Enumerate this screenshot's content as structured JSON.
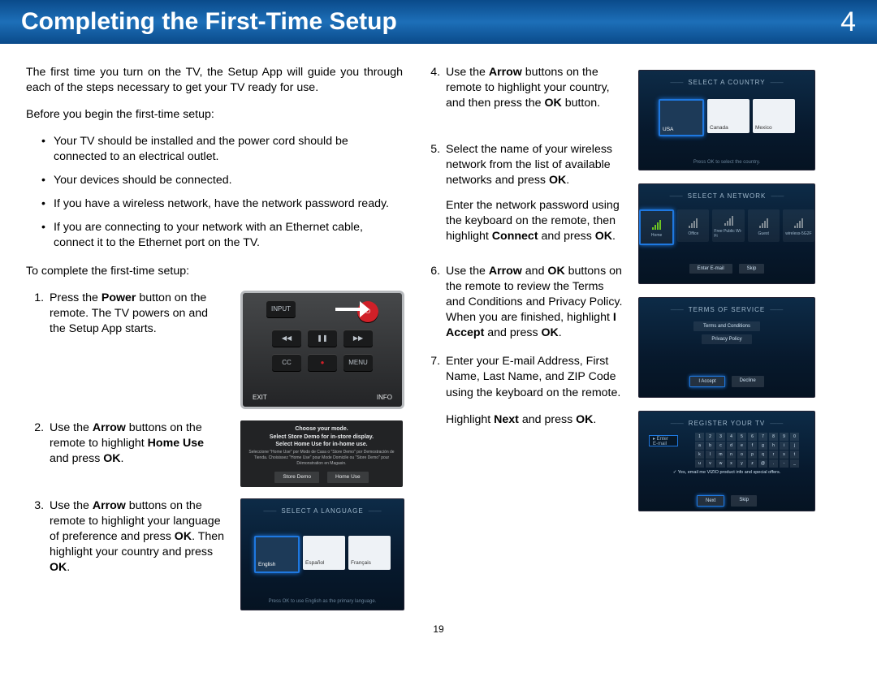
{
  "header": {
    "title": "Completing the First-Time Setup",
    "chapter": "4"
  },
  "page_num": "19",
  "intro": "The first time you turn on the TV, the Setup App will guide you through each of the steps necessary to get your TV ready for use.",
  "before": {
    "lead": "Before you begin the first-time setup:",
    "items": [
      "Your TV should be installed and the power cord should be connected to an electrical outlet.",
      "Your devices should be connected.",
      "If you have a wireless network, have the network password ready.",
      "If you are connecting to your network with an Ethernet cable, connect it to the Ethernet port on the TV."
    ]
  },
  "to_complete": "To complete the first-time setup:",
  "steps_left": [
    {
      "pre": " Press the ",
      "b1": "Power",
      "mid": " button on the remote. The TV powers on and the Setup App starts."
    },
    {
      "pre": "Use the ",
      "b1": "Arrow",
      "mid": " buttons on the remote to highlight ",
      "b2": "Home Use",
      "post": " and press ",
      "b3": "OK",
      "end": "."
    },
    {
      "pre": "Use the ",
      "b1": "Arrow",
      "mid": " buttons on the remote to highlight your language of preference and press ",
      "b2": "OK",
      "post": ". Then highlight your country and press ",
      "b3": "OK",
      "end": "."
    }
  ],
  "steps_right": [
    {
      "pre": "Use the ",
      "b1": "Arrow",
      "mid": " buttons on the remote to highlight your country, and then press the ",
      "b2": "OK",
      "post": " button."
    },
    {
      "p1": {
        "pre": "Select the name of your wireless network from the list of available networks and press ",
        "b1": "OK",
        "post": "."
      },
      "p2": {
        "pre": "Enter the network password using the keyboard on the remote, then highlight ",
        "b1": "Connect",
        "mid": " and press ",
        "b2": "OK",
        "post": "."
      }
    },
    {
      "pre": "Use the ",
      "b1": "Arrow",
      "mid": " and ",
      "b2": "OK",
      "mid2": " buttons on the remote to review the Terms and Conditions and Privacy Policy. When you are finished, highlight ",
      "b3": "I Accept",
      "post": " and press ",
      "b4": "OK",
      "end": "."
    },
    {
      "p1": {
        "text": "Enter your E-mail Address, First Name, Last Name, and ZIP Code using the keyboard on the remote."
      },
      "p2": {
        "pre": "Highlight ",
        "b1": "Next",
        "mid": " and press ",
        "b2": "OK",
        "post": "."
      }
    }
  ],
  "remote": {
    "input": "INPUT",
    "exit": "EXIT",
    "info": "INFO",
    "cc": "CC",
    "rec": "●",
    "menu": "MENU",
    "rew": "◀◀",
    "pause": "❚❚",
    "ff": "▶▶",
    "power": "⏻"
  },
  "mode": {
    "l1": "Choose your mode.",
    "l2": "Select Store Demo for in-store display.",
    "l3": "Select Home Use for in-home use.",
    "sub": "Seleccione \"Home Use\" por Modo de Casa o \"Store Demo\" por Demostración de Tienda. Choisissez \"Home Use\" pour Mode Domicile ou \"Store Demo\" pour Démonstration en Magasin.",
    "btn1": "Store Demo",
    "btn2": "Home Use"
  },
  "lang": {
    "title": "SELECT A LANGUAGE",
    "opt1": "English",
    "opt2": "Español",
    "opt3": "Français",
    "footer": "Press OK to use English as the primary language."
  },
  "country": {
    "title": "SELECT A COUNTRY",
    "opt1": "USA",
    "opt2": "Canada",
    "opt3": "Mexico",
    "footer": "Press OK to select the country."
  },
  "network": {
    "title": "SELECT A NETWORK",
    "home": "Home",
    "n2": "Office",
    "n3": "Free Public Wi-Fi",
    "n4": "Guest",
    "n5": "wireless-5G2F",
    "btn1": "Enter E-mail",
    "btn2": "Skip"
  },
  "tos": {
    "title": "TERMS OF SERVICE",
    "i1": "Terms and Conditions",
    "i2": "Privacy Policy",
    "b1": "I Accept",
    "b2": "Decline"
  },
  "register": {
    "title": "REGISTER YOUR TV",
    "field": "▸ Enter E-mail",
    "check": "✓  Yes, email me VIZIO product info and special offers.",
    "b1": "Next",
    "b2": "Skip"
  }
}
